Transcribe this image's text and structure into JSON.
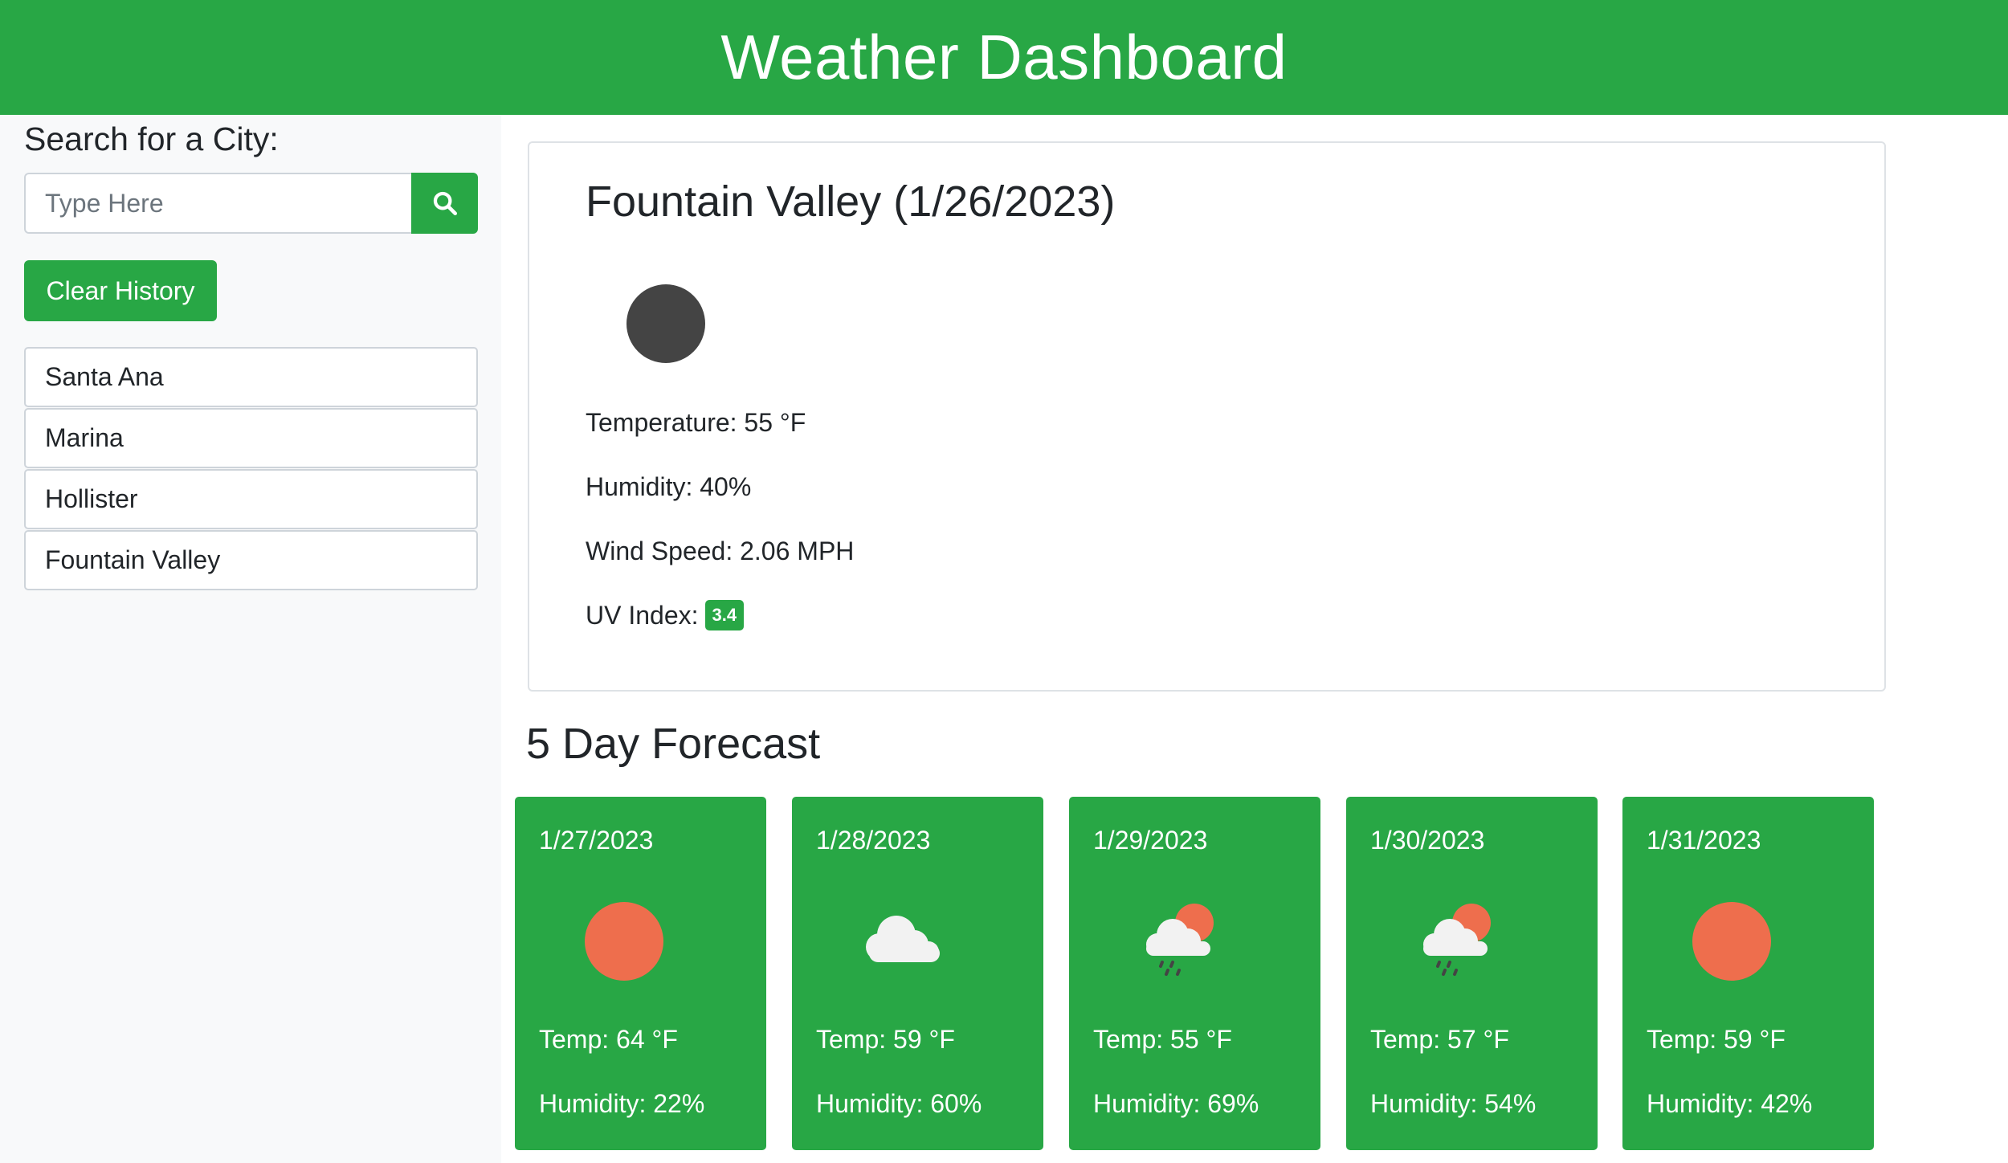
{
  "header": {
    "title": "Weather Dashboard"
  },
  "sidebar": {
    "search_label": "Search for a City:",
    "search_placeholder": "Type Here",
    "search_icon": "search-icon",
    "clear_label": "Clear History",
    "history": [
      "Santa Ana",
      "Marina",
      "Hollister",
      "Fountain Valley"
    ]
  },
  "current": {
    "title": "Fountain Valley (1/26/2023)",
    "icon": "moon-icon",
    "temperature": "Temperature: 55 °F",
    "humidity": "Humidity: 40%",
    "wind": "Wind Speed: 2.06 MPH",
    "uv_label": "UV Index:",
    "uv_value": "3.4"
  },
  "forecast": {
    "title": "5 Day Forecast",
    "days": [
      {
        "date": "1/27/2023",
        "icon": "sun-icon",
        "temp": "Temp: 64 °F",
        "humidity": "Humidity: 22%"
      },
      {
        "date": "1/28/2023",
        "icon": "cloud-icon",
        "temp": "Temp: 59 °F",
        "humidity": "Humidity: 60%"
      },
      {
        "date": "1/29/2023",
        "icon": "sun-rain-cloud-icon",
        "temp": "Temp: 55 °F",
        "humidity": "Humidity: 69%"
      },
      {
        "date": "1/30/2023",
        "icon": "sun-rain-cloud-icon",
        "temp": "Temp: 57 °F",
        "humidity": "Humidity: 54%"
      },
      {
        "date": "1/31/2023",
        "icon": "sun-icon",
        "temp": "Temp: 59 °F",
        "humidity": "Humidity: 42%"
      }
    ]
  },
  "colors": {
    "primary_green": "#28a745",
    "sun": "#ee6e4d",
    "moon": "#444444",
    "cloud": "#f2f2f2",
    "rain": "#444444"
  }
}
